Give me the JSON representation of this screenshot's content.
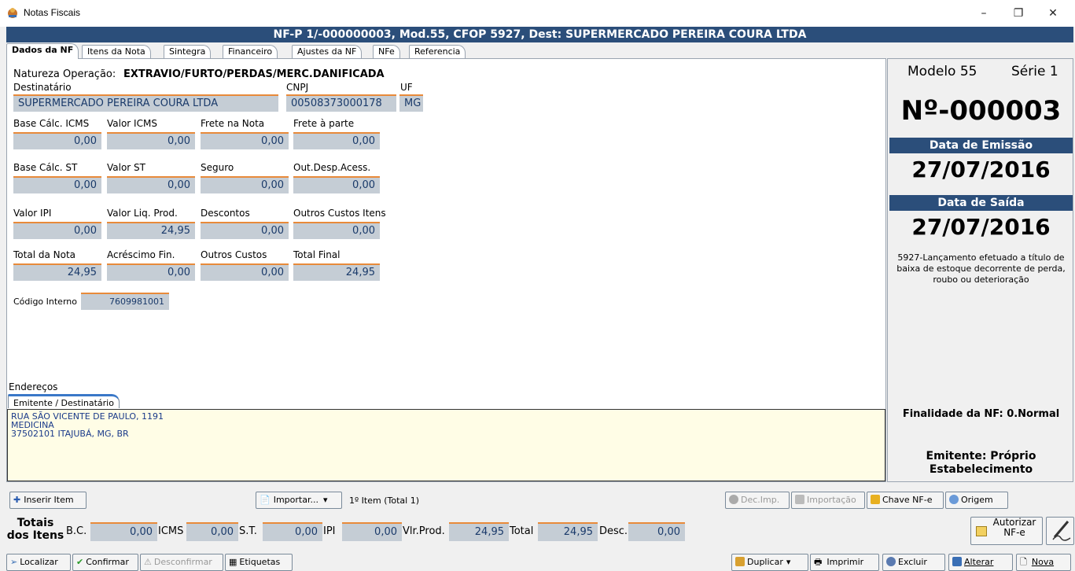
{
  "window": {
    "title": "Notas Fiscais",
    "minimize": "–",
    "restore": "❐",
    "close": "✕"
  },
  "header": "NF-P 1/-000000003, Mod.55, CFOP 5927, Dest: SUPERMERCADO PEREIRA COURA LTDA",
  "tabs": [
    "Dados da NF",
    "Itens da Nota",
    "Sintegra",
    "Financeiro",
    "Ajustes da NF",
    "NFe",
    "Referencia"
  ],
  "form": {
    "natureza_label": "Natureza Operação:",
    "natureza_value": "EXTRAVIO/FURTO/PERDAS/MERC.DANIFICADA",
    "destinatario_label": "Destinatário",
    "destinatario_value": "SUPERMERCADO PEREIRA COURA LTDA",
    "cnpj_label": "CNPJ",
    "cnpj_value": "00508373000178",
    "uf_label": "UF",
    "uf_value": "MG",
    "row1": [
      {
        "label": "Base Cálc. ICMS",
        "value": "0,00"
      },
      {
        "label": "Valor ICMS",
        "value": "0,00"
      },
      {
        "label": "Frete na Nota",
        "value": "0,00"
      },
      {
        "label": "Frete à parte",
        "value": "0,00"
      }
    ],
    "row2": [
      {
        "label": "Base Cálc. ST",
        "value": "0,00"
      },
      {
        "label": "Valor ST",
        "value": "0,00"
      },
      {
        "label": "Seguro",
        "value": "0,00"
      },
      {
        "label": "Out.Desp.Acess.",
        "value": "0,00"
      }
    ],
    "row3": [
      {
        "label": "Valor IPI",
        "value": "0,00"
      },
      {
        "label": "Valor Liq. Prod.",
        "value": "24,95"
      },
      {
        "label": "Descontos",
        "value": "0,00"
      },
      {
        "label": "Outros Custos Itens",
        "value": "0,00"
      }
    ],
    "row4": [
      {
        "label": "Total da Nota",
        "value": "24,95"
      },
      {
        "label": "Acréscimo Fin.",
        "value": "0,00"
      },
      {
        "label": "Outros Custos",
        "value": "0,00"
      },
      {
        "label": "Total Final",
        "value": "24,95"
      }
    ],
    "codigo_label": "Código Interno",
    "codigo_value": "7609981001"
  },
  "enderecos": {
    "label": "Endereços",
    "tab": "Emitente / Destinatário",
    "line1": "RUA SÃO VICENTE DE PAULO, 1191",
    "line2": "MEDICINA",
    "line3": "37502101 ITAJUBÁ, MG, BR"
  },
  "side": {
    "modelo": "Modelo 55",
    "serie": "Série 1",
    "numero": "Nº-000003",
    "emissao_label": "Data de Emissão",
    "emissao_value": "27/07/2016",
    "saida_label": "Data de Saída",
    "saida_value": "27/07/2016",
    "cfop_desc": "5927-Lançamento efetuado a título de baixa de estoque decorrente de perda, roubo ou deterioração",
    "finalidade": "Finalidade da NF: 0.Normal",
    "emitente": "Emitente: Próprio Estabelecimento"
  },
  "itembar": {
    "inserir": "Inserir Item",
    "importar": "Importar...",
    "count": "1º Item (Total 1)",
    "decimp": "Dec.Imp.",
    "importacao": "Importação",
    "chave": "Chave NF-e",
    "origem": "Origem"
  },
  "totais": {
    "title": "Totais dos Itens",
    "bc_label": "B.C.",
    "bc": "0,00",
    "icms_label": "ICMS",
    "icms": "0,00",
    "st_label": "S.T.",
    "st": "0,00",
    "ipi_label": "IPI",
    "ipi": "0,00",
    "vlprod_label": "Vlr.Prod.",
    "vlprod": "24,95",
    "total_label": "Total",
    "total": "24,95",
    "desc_label": "Desc.",
    "desc": "0,00",
    "autorizar": "Autorizar NF-e"
  },
  "bottom": {
    "localizar": "Localizar",
    "confirmar": "Confirmar",
    "desconfirmar": "Desconfirmar",
    "etiquetas": "Etiquetas",
    "duplicar": "Duplicar",
    "imprimir": "Imprimir",
    "excluir": "Excluir",
    "alterar": "Alterar",
    "nova": "Nova"
  },
  "colors": {
    "header_bg": "#2b4e7a",
    "field_bg": "#c5cdd5",
    "field_accent": "#e88a3a",
    "address_bg": "#fffde6"
  }
}
